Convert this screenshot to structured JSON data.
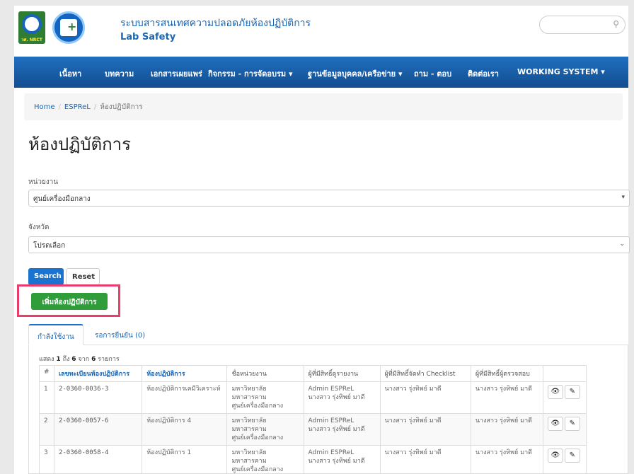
{
  "header": {
    "logo1_text": "วศ. NRCT",
    "title": "ระบบสารสนเทศความปลอดภัยห้องปฏิบัติการ",
    "subtitle": "Lab Safety",
    "search_placeholder": ""
  },
  "nav": {
    "items": [
      {
        "label": "เนื้อหา"
      },
      {
        "label": "บทความ"
      },
      {
        "label": "เอกสารเผยแพร่"
      },
      {
        "label": "กิจกรรม - การจัดอบรม ▾"
      },
      {
        "label": "ฐานข้อมูลบุคคล/เครือข่าย ▾"
      },
      {
        "label": "ถาม - ตอบ"
      },
      {
        "label": "ติดต่อเรา"
      },
      {
        "label": "WORKING SYSTEM ▾"
      }
    ]
  },
  "breadcrumb": {
    "home": "Home",
    "section": "ESPReL",
    "current": "ห้องปฏิบัติการ"
  },
  "page": {
    "title": "ห้องปฏิบัติการ"
  },
  "filters": {
    "unit_label": "หน่วยงาน",
    "unit_value": "ศูนย์เครื่องมือกลาง",
    "province_label": "จังหวัด",
    "province_value": "โปรดเลือก"
  },
  "buttons": {
    "search": "Search",
    "reset": "Reset",
    "add": "เพิ่มห้องปฏิบัติการ"
  },
  "tabs": {
    "active": "กำลังใช้งาน",
    "pending": "รอการยืนยัน (0)"
  },
  "table": {
    "entries_prefix": "แสดง",
    "entries_from": "1",
    "entries_mid": "ถึง",
    "entries_to": "6",
    "entries_of": "จาก",
    "entries_total": "6",
    "entries_suffix": "รายการ",
    "headers": [
      "#",
      "เลขทะเบียนห้องปฏิบัติการ",
      "ห้องปฏิบัติการ",
      "ชื่อหน่วยงาน",
      "ผู้ที่มีสิทธิ์ดูรายงาน",
      "ผู้ที่มีสิทธิ์จัดทำ Checklist",
      "ผู้ที่มีสิทธิ์ผู้ตรวจสอบ",
      ""
    ],
    "rows": [
      {
        "num": "1",
        "reg": "2-0360-0036-3",
        "lab": "ห้องปฏิบัติการเคมีวิเคราะห์",
        "org1": "มหาวิทยาลัยมหาสารคาม",
        "org2": "ศูนย์เครื่องมือกลาง",
        "viewer1": "Admin ESPReL",
        "viewer2": "นางสาว รุ่งทิพย์ มาดี",
        "checklist": "นางสาว รุ่งทิพย์ มาดี",
        "inspector": "นางสาว รุ่งทิพย์ มาดี"
      },
      {
        "num": "2",
        "reg": "2-0360-0057-6",
        "lab": "ห้องปฏิบัติการ 4",
        "org1": "มหาวิทยาลัยมหาสารคาม",
        "org2": "ศูนย์เครื่องมือกลาง",
        "viewer1": "Admin ESPReL",
        "viewer2": "นางสาว รุ่งทิพย์ มาดี",
        "checklist": "นางสาว รุ่งทิพย์ มาดี",
        "inspector": "นางสาว รุ่งทิพย์ มาดี"
      },
      {
        "num": "3",
        "reg": "2-0360-0058-4",
        "lab": "ห้องปฏิบัติการ 1",
        "org1": "มหาวิทยาลัยมหาสารคาม",
        "org2": "ศูนย์เครื่องมือกลาง",
        "viewer1": "Admin ESPReL",
        "viewer2": "นางสาว รุ่งทิพย์ มาดี",
        "checklist": "นางสาว รุ่งทิพย์ มาดี",
        "inspector": "นางสาว รุ่งทิพย์ มาดี"
      }
    ]
  },
  "icons": {
    "view": "eye-icon",
    "edit": "pencil-icon",
    "search": "search-icon"
  },
  "colors": {
    "primary": "#1a73d0",
    "nav": "#1a5ea8",
    "success": "#2e9d3a",
    "highlight": "#e83d6d"
  }
}
